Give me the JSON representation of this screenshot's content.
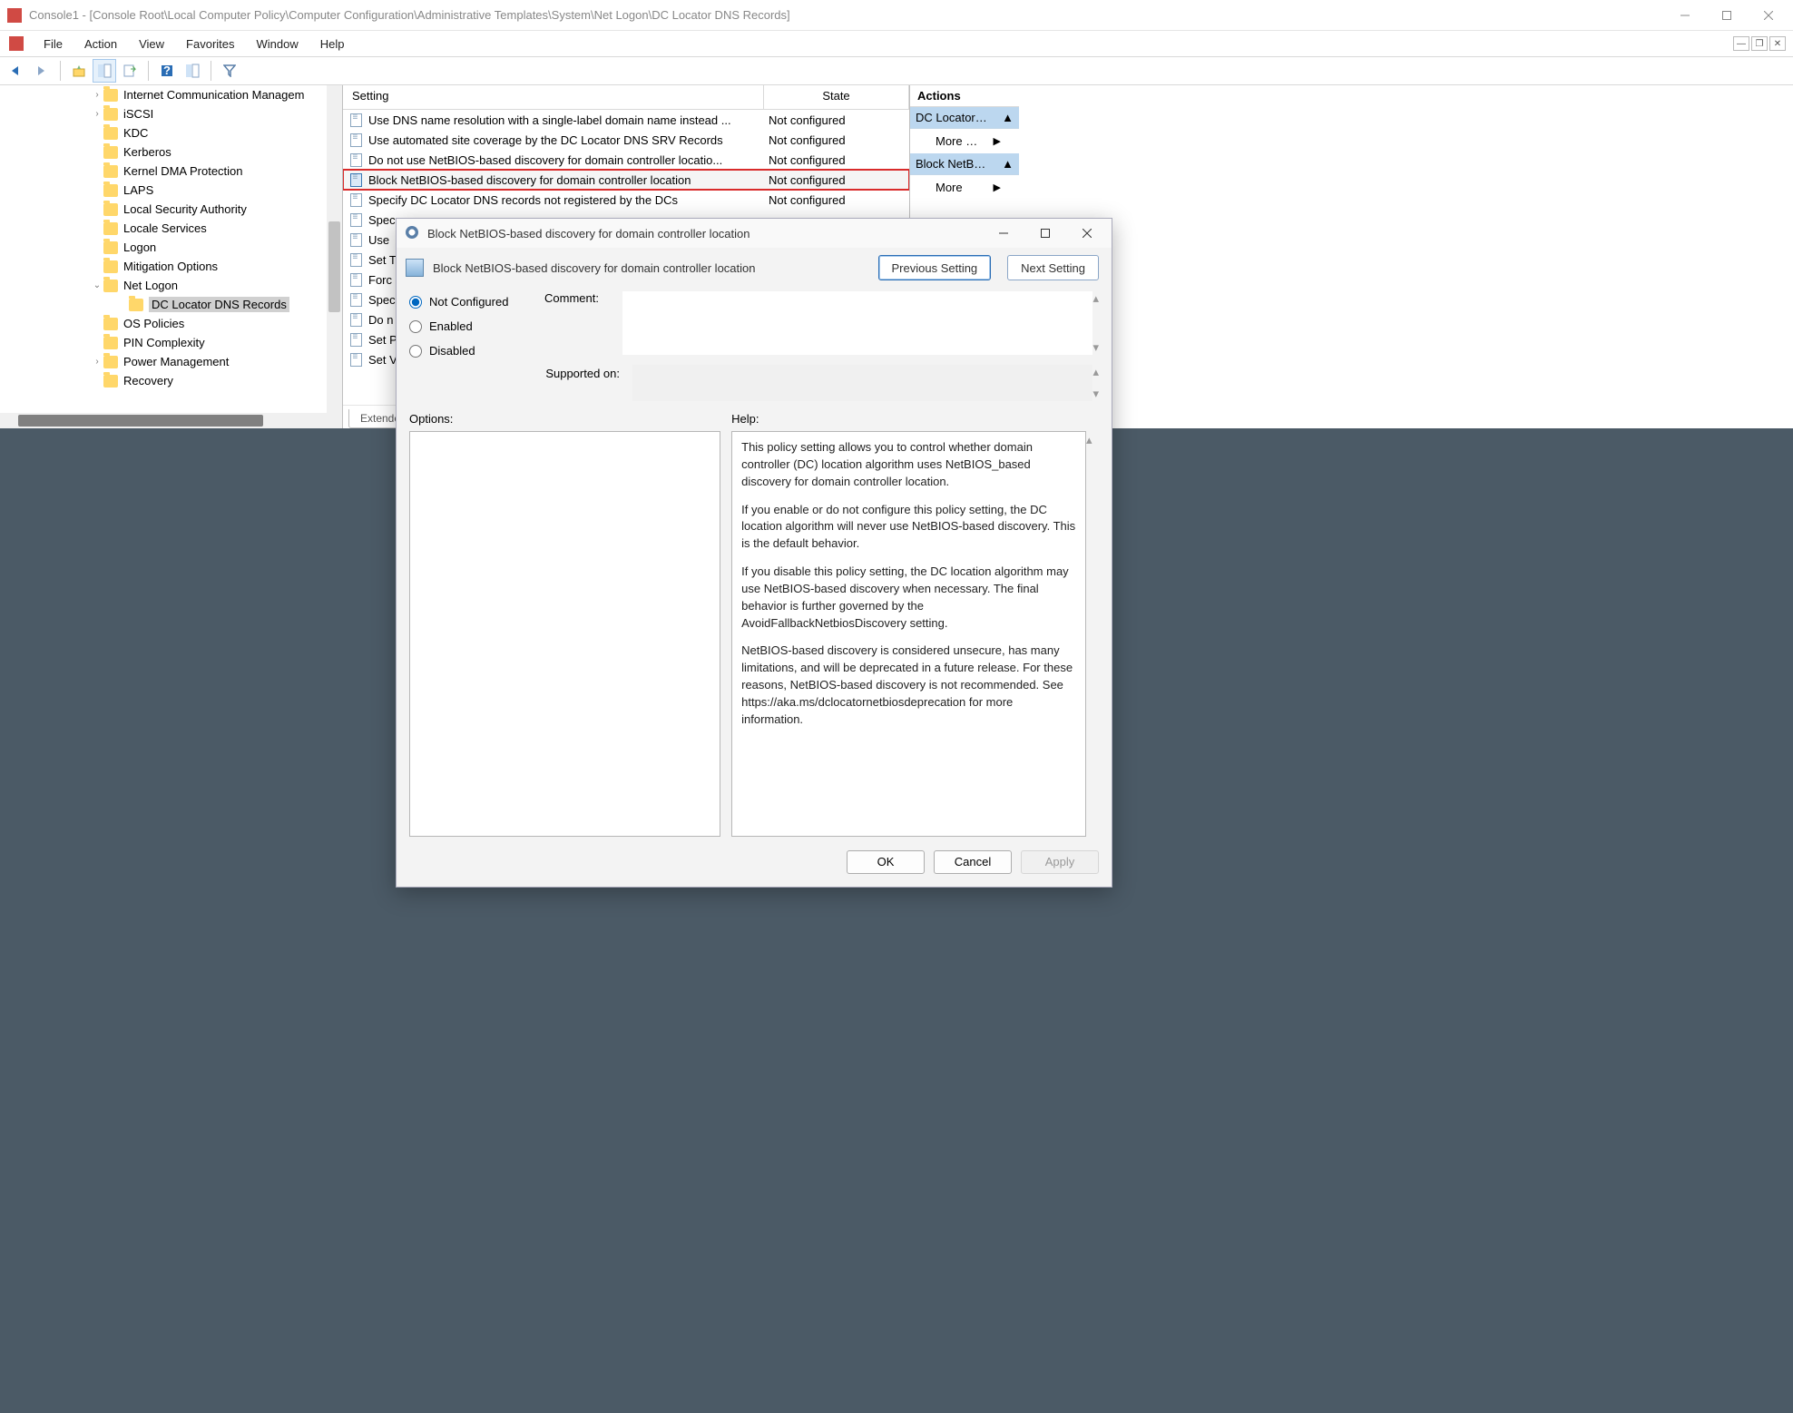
{
  "titlebar": {
    "title": "Console1 - [Console Root\\Local Computer Policy\\Computer Configuration\\Administrative Templates\\System\\Net Logon\\DC Locator DNS Records]"
  },
  "menubar": {
    "items": [
      "File",
      "Action",
      "View",
      "Favorites",
      "Window",
      "Help"
    ]
  },
  "tree": {
    "items": [
      {
        "label": "Internet Communication Managem",
        "expander": "›",
        "indent": 100
      },
      {
        "label": "iSCSI",
        "expander": "›",
        "indent": 100
      },
      {
        "label": "KDC",
        "expander": "",
        "indent": 100
      },
      {
        "label": "Kerberos",
        "expander": "",
        "indent": 100
      },
      {
        "label": "Kernel DMA Protection",
        "expander": "",
        "indent": 100
      },
      {
        "label": "LAPS",
        "expander": "",
        "indent": 100
      },
      {
        "label": "Local Security Authority",
        "expander": "",
        "indent": 100
      },
      {
        "label": "Locale Services",
        "expander": "",
        "indent": 100
      },
      {
        "label": "Logon",
        "expander": "",
        "indent": 100
      },
      {
        "label": "Mitigation Options",
        "expander": "",
        "indent": 100
      },
      {
        "label": "Net Logon",
        "expander": "⌄",
        "indent": 100
      },
      {
        "label": "DC Locator DNS Records",
        "expander": "",
        "indent": 128,
        "selected": true
      },
      {
        "label": "OS Policies",
        "expander": "",
        "indent": 100
      },
      {
        "label": "PIN Complexity",
        "expander": "",
        "indent": 100
      },
      {
        "label": "Power Management",
        "expander": "›",
        "indent": 100
      },
      {
        "label": "Recovery",
        "expander": "",
        "indent": 100
      }
    ]
  },
  "list": {
    "col_setting": "Setting",
    "col_state": "State",
    "rows": [
      {
        "text": "Use DNS name resolution with a single-label domain name instead ...",
        "state": "Not configured"
      },
      {
        "text": "Use automated site coverage by the DC Locator DNS SRV Records",
        "state": "Not configured"
      },
      {
        "text": "Do not use NetBIOS-based discovery for domain controller locatio...",
        "state": "Not configured"
      },
      {
        "text": "Block NetBIOS-based discovery for domain controller location",
        "state": "Not configured",
        "highlighted": true
      },
      {
        "text": "Specify DC Locator DNS records not registered by the DCs",
        "state": "Not configured"
      },
      {
        "text": "Spec",
        "state": ""
      },
      {
        "text": "Use",
        "state": ""
      },
      {
        "text": "Set T",
        "state": ""
      },
      {
        "text": "Forc",
        "state": ""
      },
      {
        "text": "Spec",
        "state": ""
      },
      {
        "text": "Do n",
        "state": ""
      },
      {
        "text": "Set P",
        "state": ""
      },
      {
        "text": "Set V",
        "state": ""
      }
    ],
    "tab": "Extende"
  },
  "actions": {
    "header": "Actions",
    "group1": "DC Locator…",
    "link1": "More …",
    "group2": "Block NetB…",
    "link2": "More"
  },
  "dialog": {
    "title": "Block NetBIOS-based discovery for domain controller location",
    "subtitle": "Block NetBIOS-based discovery for domain controller location",
    "prev": "Previous Setting",
    "next": "Next Setting",
    "radio_nc": "Not Configured",
    "radio_en": "Enabled",
    "radio_dis": "Disabled",
    "comment_label": "Comment:",
    "supported_label": "Supported on:",
    "options_label": "Options:",
    "help_label": "Help:",
    "help_text": "This policy setting allows you to control whether domain controller (DC) location algorithm uses NetBIOS_based discovery for domain controller location.\n\nIf you enable or do not configure this policy setting, the DC location algorithm will never use NetBIOS-based discovery. This is the default behavior.\n\nIf you disable this policy setting, the DC location algorithm may use NetBIOS-based discovery when necessary. The final behavior is further governed by the AvoidFallbackNetbiosDiscovery setting.\n\nNetBIOS-based discovery is considered unsecure, has many limitations, and will be deprecated in a future release. For these reasons, NetBIOS-based discovery is not recommended. See https://aka.ms/dclocatornetbiosdeprecation for more information.",
    "ok": "OK",
    "cancel": "Cancel",
    "apply": "Apply"
  }
}
